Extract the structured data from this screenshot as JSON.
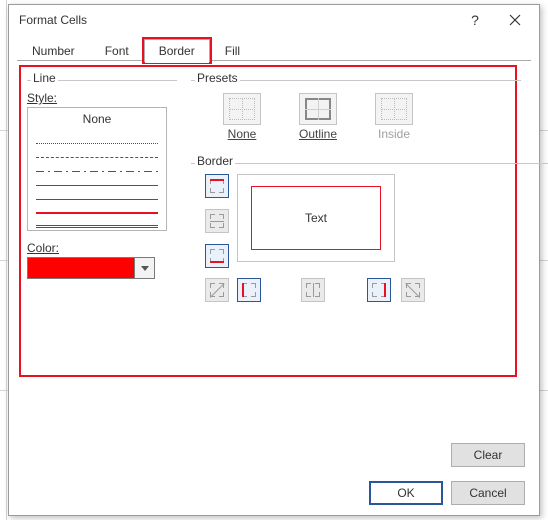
{
  "dialog": {
    "title": "Format Cells",
    "help_tooltip": "?",
    "close_tooltip": "×"
  },
  "tabs": {
    "number": "Number",
    "font": "Font",
    "border": "Border",
    "fill": "Fill",
    "active": "border"
  },
  "line_group": {
    "label": "Line",
    "style_label": "Style:",
    "style_none": "None",
    "color_label": "Color:",
    "color_value": "#FF0000"
  },
  "presets_group": {
    "label": "Presets",
    "none": "None",
    "outline": "Outline",
    "inside": "Inside"
  },
  "border_group": {
    "label": "Border",
    "preview_text": "Text"
  },
  "buttons": {
    "clear": "Clear",
    "ok": "OK",
    "cancel": "Cancel"
  }
}
